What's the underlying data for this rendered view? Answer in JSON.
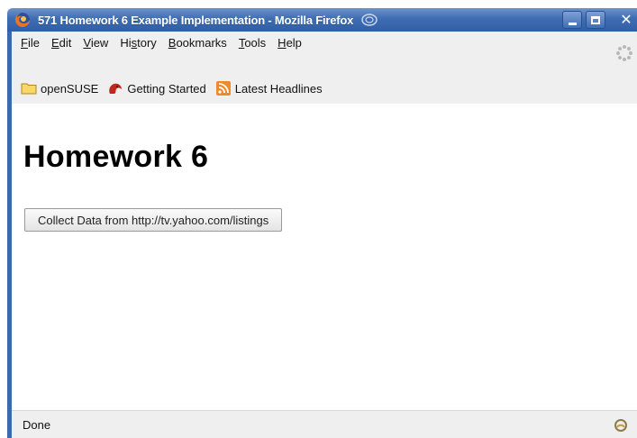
{
  "window": {
    "title": "571 Homework 6 Example Implementation - Mozilla Firefox"
  },
  "menu": {
    "items": [
      {
        "label": "File",
        "accel": "F",
        "rest": "ile"
      },
      {
        "label": "Edit",
        "accel": "E",
        "rest": "dit"
      },
      {
        "label": "View",
        "accel": "V",
        "rest": "iew"
      },
      {
        "label": "History",
        "pre": "Hi",
        "accel": "s",
        "rest": "tory"
      },
      {
        "label": "Bookmarks",
        "accel": "B",
        "rest": "ookmarks"
      },
      {
        "label": "Tools",
        "accel": "T",
        "rest": "ools"
      },
      {
        "label": "Help",
        "accel": "H",
        "rest": "elp"
      }
    ]
  },
  "bookmarks": {
    "items": [
      {
        "label": "openSUSE",
        "icon": "folder-icon"
      },
      {
        "label": "Getting Started",
        "icon": "getting-started-icon"
      },
      {
        "label": "Latest Headlines",
        "icon": "rss-feed-icon"
      }
    ]
  },
  "page": {
    "heading": "Homework 6",
    "button_label": "Collect Data from http://tv.yahoo.com/listings"
  },
  "status": {
    "text": "Done"
  },
  "colors": {
    "titlebar": "#3e6db3",
    "chrome": "#efefef"
  }
}
